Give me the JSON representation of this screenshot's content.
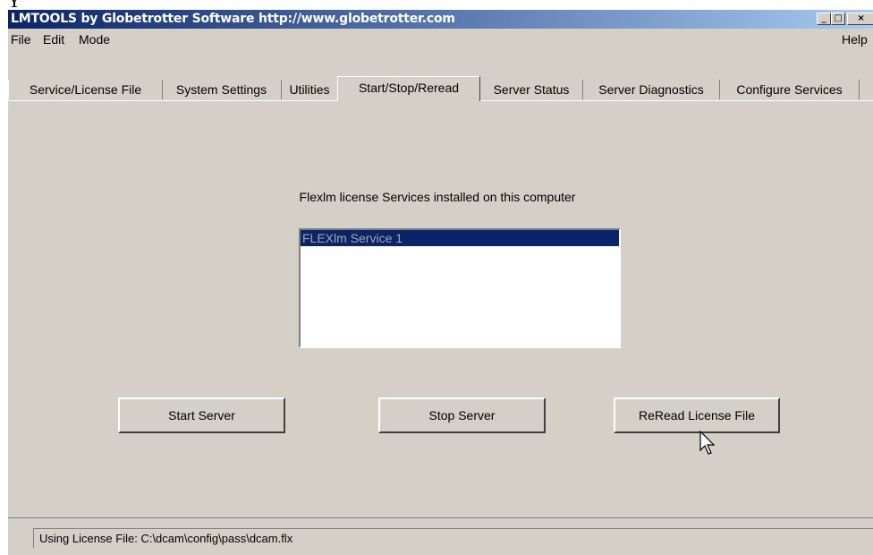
{
  "cropped_text": "Y",
  "window": {
    "title": "LMTOOLS by Globetrotter Software http://www.globetrotter.com",
    "controls": [
      "_",
      "□",
      "×"
    ]
  },
  "menu": {
    "file": "File",
    "edit": "Edit",
    "mode": "Mode",
    "help": "Help"
  },
  "tabs": [
    {
      "label": "Service/License File"
    },
    {
      "label": "System Settings"
    },
    {
      "label": "Utilities"
    },
    {
      "label": "Start/Stop/Reread",
      "active": true
    },
    {
      "label": "Server Status"
    },
    {
      "label": "Server Diagnostics"
    },
    {
      "label": "Configure Services"
    }
  ],
  "panel": {
    "caption": "Flexlm license Services installed on this computer",
    "services": [
      "FLEXlm Service 1"
    ],
    "selected_service": "FLEXlm Service 1",
    "start_button": "Start Server",
    "stop_button": "Stop Server",
    "reread_button": "ReRead License File"
  },
  "status": {
    "text": "Using License File:  C:\\dcam\\config\\pass\\dcam.flx"
  },
  "colors": {
    "titlebar_start": "#0a246a",
    "titlebar_end": "#a6caf0",
    "face": "#d4d0c8",
    "selection": "#0a246a"
  }
}
